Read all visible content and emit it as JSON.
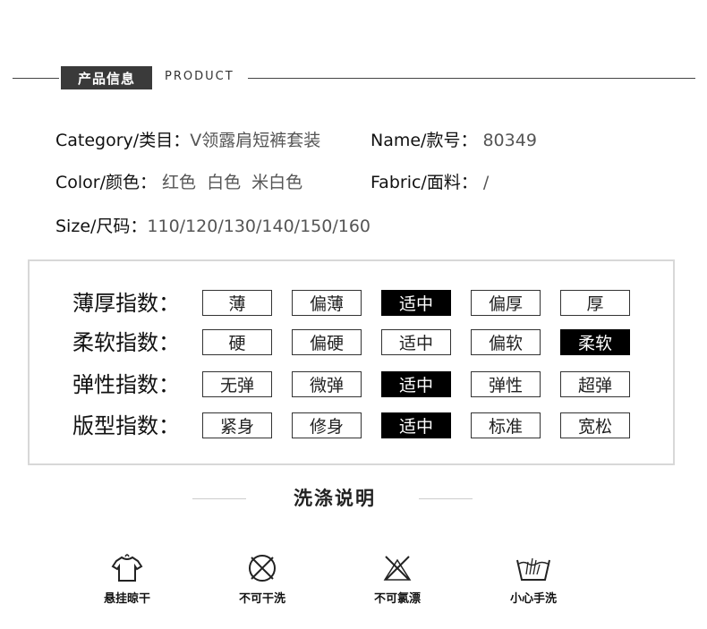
{
  "header": {
    "badge": "产品信息",
    "subtitle": "PRODUCT"
  },
  "info": {
    "category_label": "Category/类目：",
    "category_value": "V领露肩短裤套装",
    "name_label": "Name/款号：",
    "name_value": "80349",
    "color_label": "Color/颜色：",
    "color_value": "红色  白色  米白色",
    "fabric_label": "Fabric/面料：",
    "fabric_value": "/",
    "size_label": "Size/尺码：",
    "size_value": "110/120/130/140/150/160"
  },
  "indices": [
    {
      "label": "薄厚指数：",
      "options": [
        "薄",
        "偏薄",
        "适中",
        "偏厚",
        "厚"
      ],
      "selected": 2
    },
    {
      "label": "柔软指数：",
      "options": [
        "硬",
        "偏硬",
        "适中",
        "偏软",
        "柔软"
      ],
      "selected": 4
    },
    {
      "label": "弹性指数：",
      "options": [
        "无弹",
        "微弹",
        "适中",
        "弹性",
        "超弹"
      ],
      "selected": 2
    },
    {
      "label": "版型指数：",
      "options": [
        "紧身",
        "修身",
        "适中",
        "标准",
        "宽松"
      ],
      "selected": 2
    }
  ],
  "washing": {
    "title": "洗涤说明",
    "items": [
      {
        "icon": "hang-dry-icon",
        "caption": "悬挂晾干"
      },
      {
        "icon": "no-dry-clean-icon",
        "caption": "不可干洗"
      },
      {
        "icon": "no-bleach-icon",
        "caption": "不可氯漂"
      },
      {
        "icon": "hand-wash-icon",
        "caption": "小心手洗"
      }
    ]
  }
}
